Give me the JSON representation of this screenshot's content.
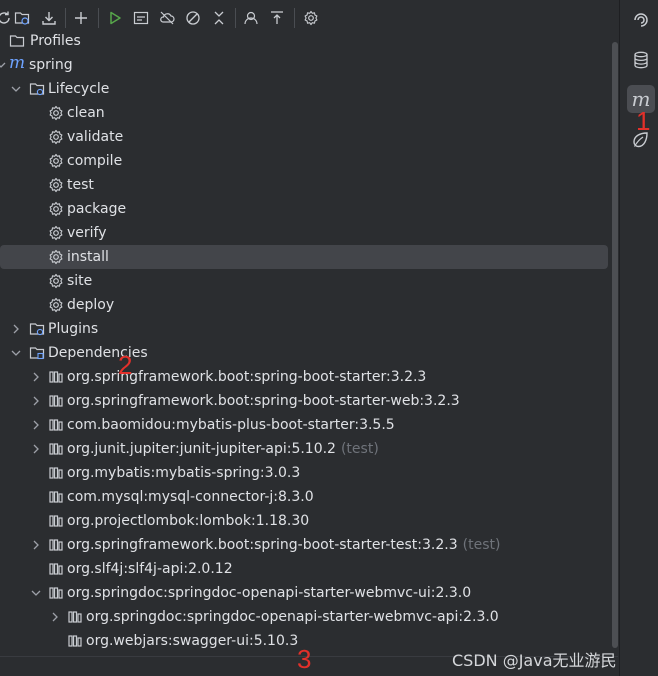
{
  "toolbar": {
    "buttons": [
      "refresh-icon",
      "folder-sync-icon",
      "download-icon",
      "add-icon",
      "run-icon",
      "run-config-icon",
      "offline-icon",
      "skip-tests-icon",
      "collapse-icon",
      "show-deps-icon",
      "collapse-all-icon",
      "settings-icon"
    ]
  },
  "tree": {
    "profiles": "Profiles",
    "project": "spring",
    "lifecycle": {
      "label": "Lifecycle",
      "phases": [
        "clean",
        "validate",
        "compile",
        "test",
        "package",
        "verify",
        "install",
        "site",
        "deploy"
      ],
      "selected": "install"
    },
    "plugins": "Plugins",
    "dependencies": {
      "label": "Dependencies",
      "items": [
        {
          "name": "org.springframework.boot:spring-boot-starter:3.2.3",
          "scope": ""
        },
        {
          "name": "org.springframework.boot:spring-boot-starter-web:3.2.3",
          "scope": ""
        },
        {
          "name": "com.baomidou:mybatis-plus-boot-starter:3.5.5",
          "scope": ""
        },
        {
          "name": "org.junit.jupiter:junit-jupiter-api:5.10.2",
          "scope": "(test)"
        },
        {
          "name": "org.mybatis:mybatis-spring:3.0.3",
          "scope": ""
        },
        {
          "name": "com.mysql:mysql-connector-j:8.3.0",
          "scope": ""
        },
        {
          "name": "org.projectlombok:lombok:1.18.30",
          "scope": ""
        },
        {
          "name": "org.springframework.boot:spring-boot-starter-test:3.2.3",
          "scope": "(test)"
        },
        {
          "name": "org.slf4j:slf4j-api:2.0.12",
          "scope": ""
        },
        {
          "name": "org.springdoc:springdoc-openapi-starter-webmvc-ui:2.3.0",
          "scope": ""
        }
      ],
      "nested": [
        {
          "name": "org.springdoc:springdoc-openapi-starter-webmvc-api:2.3.0"
        },
        {
          "name": "org.webjars:swagger-ui:5.10.3"
        }
      ]
    }
  },
  "rightbar": {
    "buttons": [
      "notifications-icon",
      "database-icon",
      "maven-icon",
      "spring-icon"
    ],
    "maven_glyph": "m",
    "active": "maven-icon"
  },
  "annotations": [
    "1",
    "2",
    "3"
  ],
  "watermark": "CSDN @Java无业游民",
  "colors": {
    "background": "#2b2d30",
    "selection": "#43454a",
    "muted_text": "#6f737a",
    "run_green": "#57a64a",
    "annotation_red": "#e2302a"
  }
}
